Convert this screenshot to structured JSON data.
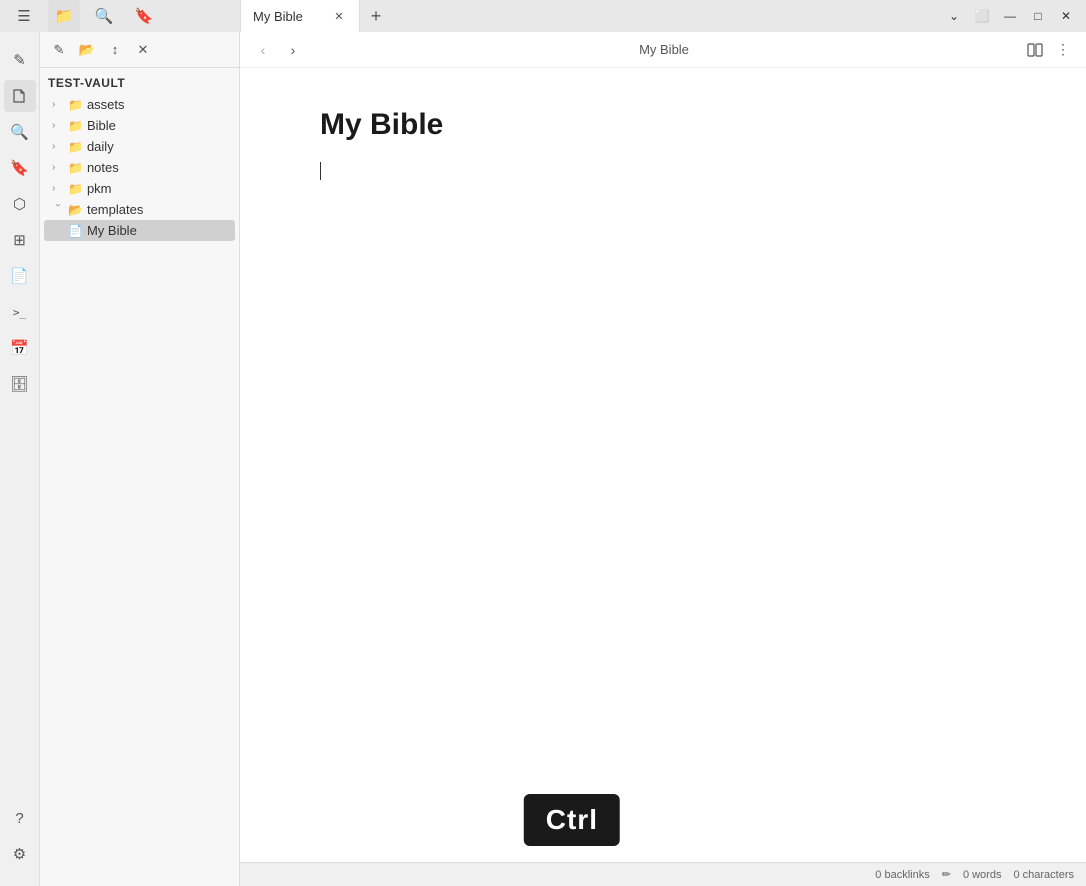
{
  "titlebar": {
    "tab_label": "My Bible",
    "new_tab_icon": "+",
    "minimize_icon": "—",
    "maximize_icon": "□",
    "close_icon": "✕",
    "collapse_icon": "⌄",
    "split_icon": "⬜"
  },
  "icon_sidebar": {
    "icons": [
      {
        "name": "sidebar-toggle-icon",
        "glyph": "☰"
      },
      {
        "name": "folder-icon",
        "glyph": "📁"
      },
      {
        "name": "search-icon",
        "glyph": "🔍"
      },
      {
        "name": "bookmark-icon",
        "glyph": "🔖"
      },
      {
        "name": "graph-icon",
        "glyph": "⬡"
      },
      {
        "name": "extensions-icon",
        "glyph": "⊞"
      },
      {
        "name": "pages-icon",
        "glyph": "📄"
      },
      {
        "name": "terminal-icon",
        "glyph": ">_"
      },
      {
        "name": "calendar-icon",
        "glyph": "📅"
      },
      {
        "name": "archive-icon",
        "glyph": "🗄"
      }
    ],
    "bottom_icons": [
      {
        "name": "help-icon",
        "glyph": "?"
      },
      {
        "name": "settings-icon",
        "glyph": "⚙"
      }
    ]
  },
  "file_sidebar": {
    "vault_name": "TEST-VAULT",
    "toolbar_icons": [
      {
        "name": "new-note-icon",
        "glyph": "✎"
      },
      {
        "name": "new-folder-icon",
        "glyph": "📂"
      },
      {
        "name": "sort-icon",
        "glyph": "↕"
      },
      {
        "name": "collapse-all-icon",
        "glyph": "✕"
      }
    ],
    "tree": [
      {
        "label": "assets",
        "type": "folder",
        "expanded": false,
        "indent": 0
      },
      {
        "label": "Bible",
        "type": "folder",
        "expanded": false,
        "indent": 0
      },
      {
        "label": "daily",
        "type": "folder",
        "expanded": false,
        "indent": 0
      },
      {
        "label": "notes",
        "type": "folder",
        "expanded": false,
        "indent": 0
      },
      {
        "label": "pkm",
        "type": "folder",
        "expanded": false,
        "indent": 0
      },
      {
        "label": "templates",
        "type": "folder",
        "expanded": true,
        "indent": 0
      },
      {
        "label": "My Bible",
        "type": "file",
        "active": true,
        "indent": 1
      }
    ]
  },
  "editor": {
    "title_bar": "My Bible",
    "doc_title": "My Bible",
    "backlinks": "0 backlinks",
    "words": "0 words",
    "characters": "0 characters"
  },
  "ctrl_overlay": {
    "text": "Ctrl"
  }
}
